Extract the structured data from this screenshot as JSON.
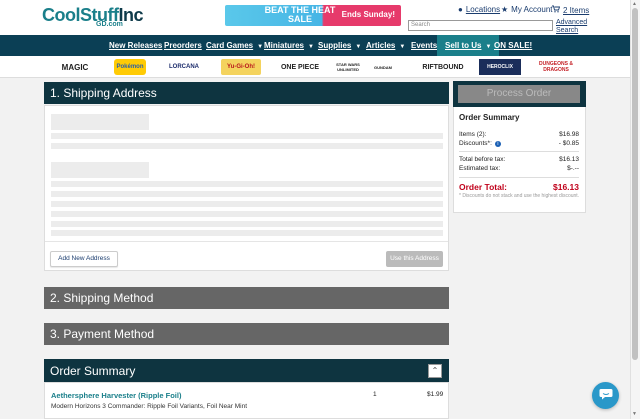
{
  "header": {
    "logo_main": "CoolStuff",
    "logo_inc": "Inc",
    "logo_sub": "GD.com",
    "banner_title": "BEAT THE HEAT SALE",
    "banner_ends": "Ends Sunday!",
    "locations": "Locations",
    "my_account": "My Account",
    "cart_items": "2 Items",
    "search_placeholder": "Search",
    "advanced_search": "Advanced Search"
  },
  "nav": {
    "items": [
      {
        "label": "New Releases",
        "has_menu": false
      },
      {
        "label": "Preorders",
        "has_menu": false
      },
      {
        "label": "Card Games",
        "has_menu": true
      },
      {
        "label": "Miniatures",
        "has_menu": true
      },
      {
        "label": "Supplies",
        "has_menu": true
      },
      {
        "label": "Articles",
        "has_menu": true
      },
      {
        "label": "Events",
        "has_menu": false
      },
      {
        "label": "Sell to Us",
        "has_menu": true
      },
      {
        "label": "ON SALE!",
        "has_menu": false
      }
    ]
  },
  "brands": [
    "MAGIC",
    "Pokémon",
    "LORCANA",
    "Yu-Gi-Oh!",
    "ONE PIECE",
    "STAR WARS UNLIMITED",
    "GUNDAM",
    "RIFTBOUND",
    "HEROCLIX",
    "DUNGEONS & DRAGONS"
  ],
  "checkout": {
    "shipping_address_title": "1. Shipping Address",
    "add_address_label": "Add New Address",
    "use_address_label": "Use this Address",
    "shipping_method_title": "2. Shipping Method",
    "payment_method_title": "3. Payment Method",
    "order_summary_title": "Order Summary",
    "collapse_label": "⌃"
  },
  "order_item": {
    "name": "Aethersphere Harvester (Ripple Foil)",
    "set": "Modern Horizons 3 Commander: Ripple Foil Variants, Foil Near Mint",
    "qty": "1",
    "price": "$1.99"
  },
  "summary": {
    "process_label": "Process Order",
    "title": "Order Summary",
    "items_label": "Items (2):",
    "items_value": "$16.98",
    "discounts_label": "Discounts*:",
    "discounts_value": "- $0.85",
    "before_tax_label": "Total before tax:",
    "before_tax_value": "$16.13",
    "est_tax_label": "Estimated tax:",
    "est_tax_value": "$-.--",
    "total_label": "Order Total:",
    "total_value": "$16.13",
    "note": "* Discounts do not stack and use the highest discount."
  },
  "colors": {
    "nav_bg": "#0b3f55",
    "accent": "#1a7f8a",
    "total_red": "#c0001a",
    "panel_dark": "#0e3440",
    "panel_grey": "#666666"
  }
}
